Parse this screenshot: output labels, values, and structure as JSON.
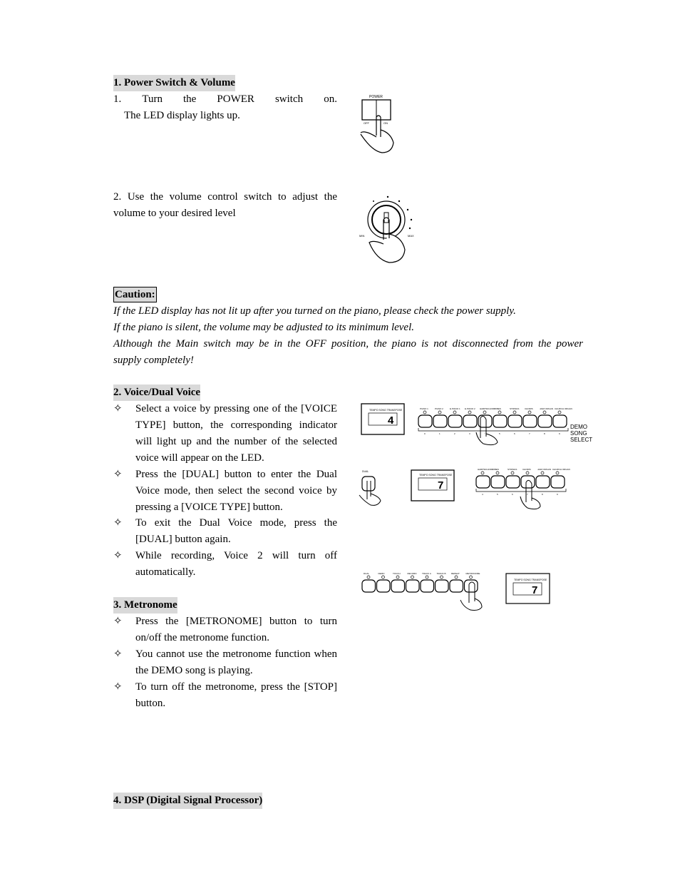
{
  "s1": {
    "heading": "1. Power Switch & Volume",
    "step1_a": "1.",
    "step1_b": "Turn",
    "step1_c": "the",
    "step1_d": "POWER",
    "step1_e": "switch",
    "step1_f": "on.",
    "step1_line2": "The LED display lights up.",
    "step2_line1": "2. Use the volume control switch to adjust the",
    "step2_line2": "volume to your desired level",
    "fig_power": {
      "label": "POWER",
      "off": "OFF",
      "on": "ON"
    },
    "fig_volume": {
      "min": "MIN",
      "max": "MAX"
    }
  },
  "caution": {
    "heading": "Caution:",
    "line1": "If the LED display has not lit up after you turned on the piano, please check the power supply.",
    "line2": "If the piano is silent, the volume may be adjusted to its minimum level.",
    "line3": "Although the Main switch may be in the OFF position, the piano is not disconnected from the power",
    "line4": "supply completely!"
  },
  "s2": {
    "heading": "2. Voice/Dual Voice",
    "bullet": "✧",
    "items": [
      "Select a voice by pressing one of the [VOICE TYPE] button, the corresponding indicator will light up and the number of the selected voice will appear on the LED.",
      "Press the [DUAL] button to enter the Dual Voice mode, then select the second voice by pressing a [VOICE TYPE] button.",
      "To exit the Dual Voice mode, press the [DUAL] button again.",
      "While recording, Voice 2 will turn off automatically."
    ],
    "fig": {
      "led_label": "TEMPO  SONG  TRANSPOSE",
      "led1": "4",
      "led2": "7",
      "dual": "DUAL",
      "voices": [
        "PIANO 1",
        "PIANO 2",
        "E.PIANO 1",
        "E.PIANO 2",
        "HARPSICHORD",
        "VIBES",
        "STRINGS",
        "CHOIRS",
        "JAZZ ORGAN",
        "CHURCH ORGAN"
      ],
      "numbers": [
        "0",
        "1",
        "2",
        "3",
        "4",
        "5",
        "6",
        "7",
        "8",
        "9"
      ],
      "select": "DEMO SONG SELECT"
    }
  },
  "s3": {
    "heading": "3. Metronome",
    "bullet": "✧",
    "items": [
      "Press the [METRONOME] button to turn on/off the metronome function.",
      "You cannot use the metronome function when the DEMO song is playing.",
      "To turn off the metronome, press the [STOP] button."
    ],
    "fig": {
      "buttons": [
        "DUAL",
        "DEMO",
        "TOUCH",
        "RECORD",
        "TRACK A",
        "TRACK B",
        "REPEAT",
        "METRONOME"
      ],
      "led": "7"
    }
  },
  "s4": {
    "heading": "4. DSP (Digital Signal Processor)"
  }
}
